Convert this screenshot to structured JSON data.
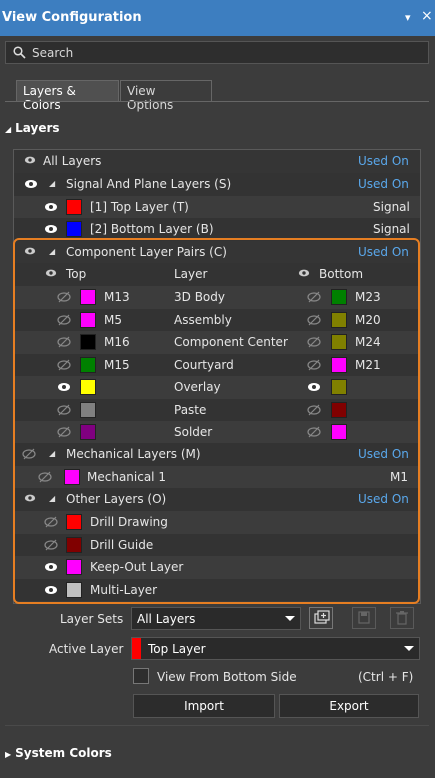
{
  "window": {
    "title": "View Configuration",
    "pin_glyph": "▾",
    "close_glyph": "×"
  },
  "search": {
    "placeholder": "Search"
  },
  "tabs": [
    {
      "label": "Layers & Colors"
    },
    {
      "label": "View Options"
    }
  ],
  "sections": {
    "layers": "Layers",
    "system_colors": "System Colors"
  },
  "colors": {
    "accent": "#3d7ec0",
    "highlight": "#e67e22",
    "link": "#5aa8ec"
  },
  "tree": {
    "all_layers": {
      "label": "All Layers",
      "status": "Used On"
    },
    "signal": {
      "label": "Signal And Plane Layers (S)",
      "status": "Used On",
      "items": [
        {
          "label": "[1] Top Layer (T)",
          "value": "Signal",
          "color": "#ff0000"
        },
        {
          "label": "[2] Bottom Layer (B)",
          "value": "Signal",
          "color": "#0000ff"
        }
      ]
    },
    "component": {
      "label": "Component Layer Pairs (C)",
      "status": "Used On",
      "col_top": "Top",
      "col_layer": "Layer",
      "col_bottom": "Bottom",
      "pairs": [
        {
          "top_name": "M13",
          "top_color": "#ff00ff",
          "top_visible": false,
          "layer": "3D Body",
          "bottom_name": "M23",
          "bottom_color": "#008000",
          "bottom_visible": false
        },
        {
          "top_name": "M5",
          "top_color": "#ff00ff",
          "top_visible": false,
          "layer": "Assembly",
          "bottom_name": "M20",
          "bottom_color": "#808000",
          "bottom_visible": false
        },
        {
          "top_name": "M16",
          "top_color": "#000000",
          "top_visible": false,
          "layer": "Component Center",
          "bottom_name": "M24",
          "bottom_color": "#808000",
          "bottom_visible": false
        },
        {
          "top_name": "M15",
          "top_color": "#008000",
          "top_visible": false,
          "layer": "Courtyard",
          "bottom_name": "M21",
          "bottom_color": "#ff00ff",
          "bottom_visible": false
        },
        {
          "top_name": "",
          "top_color": "#ffff00",
          "top_visible": true,
          "layer": "Overlay",
          "bottom_name": "",
          "bottom_color": "#808000",
          "bottom_visible": true
        },
        {
          "top_name": "",
          "top_color": "#808080",
          "top_visible": false,
          "layer": "Paste",
          "bottom_name": "",
          "bottom_color": "#800000",
          "bottom_visible": false
        },
        {
          "top_name": "",
          "top_color": "#800080",
          "top_visible": false,
          "layer": "Solder",
          "bottom_name": "",
          "bottom_color": "#ff00ff",
          "bottom_visible": false
        }
      ]
    },
    "mechanical": {
      "label": "Mechanical Layers (M)",
      "status": "Used On",
      "items": [
        {
          "label": "Mechanical 1",
          "value": "M1",
          "color": "#ff00ff"
        }
      ]
    },
    "other": {
      "label": "Other Layers (O)",
      "status": "Used On",
      "items": [
        {
          "label": "Drill Drawing",
          "color": "#ff0000",
          "visible": false
        },
        {
          "label": "Drill Guide",
          "color": "#800000",
          "visible": false
        },
        {
          "label": "Keep-Out Layer",
          "color": "#ff00ff",
          "visible": true
        },
        {
          "label": "Multi-Layer",
          "color": "#c0c0c0",
          "visible": true
        }
      ]
    }
  },
  "layer_sets": {
    "label": "Layer Sets",
    "value": "All Layers"
  },
  "active_layer": {
    "label": "Active Layer",
    "value": "Top Layer",
    "color": "#ff0000"
  },
  "view_from_bottom": {
    "label": "View From Bottom Side",
    "shortcut": "(Ctrl + F)"
  },
  "buttons": {
    "import": "Import",
    "export": "Export"
  }
}
